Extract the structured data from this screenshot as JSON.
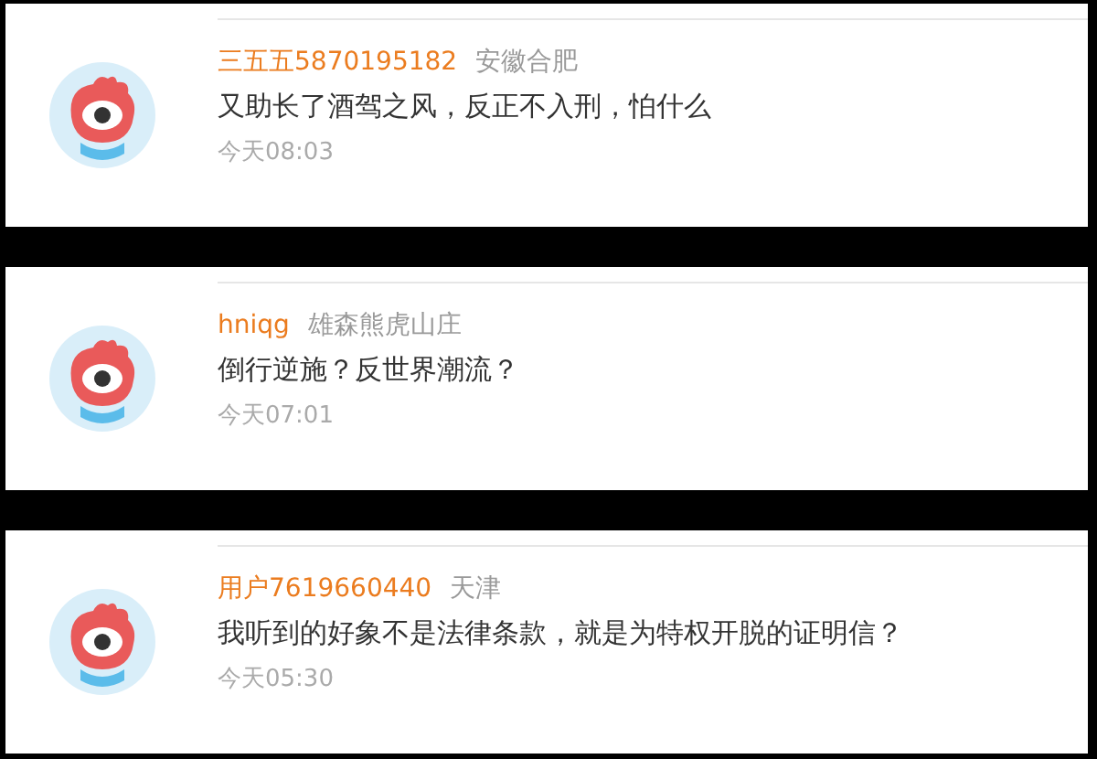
{
  "comments": [
    {
      "user": "三五五5870195182",
      "location": "安徽合肥",
      "text": "又助长了酒驾之风，反正不入刑，怕什么",
      "time": "今天08:03"
    },
    {
      "user": "hniqg",
      "location": "雄森熊虎山庄",
      "text": "倒行逆施？反世界潮流？",
      "time": "今天07:01"
    },
    {
      "user": "用户7619660440",
      "location": "天津",
      "text": "我听到的好象不是法律条款，就是为特权开脱的证明信？",
      "time": "今天05:30"
    }
  ]
}
